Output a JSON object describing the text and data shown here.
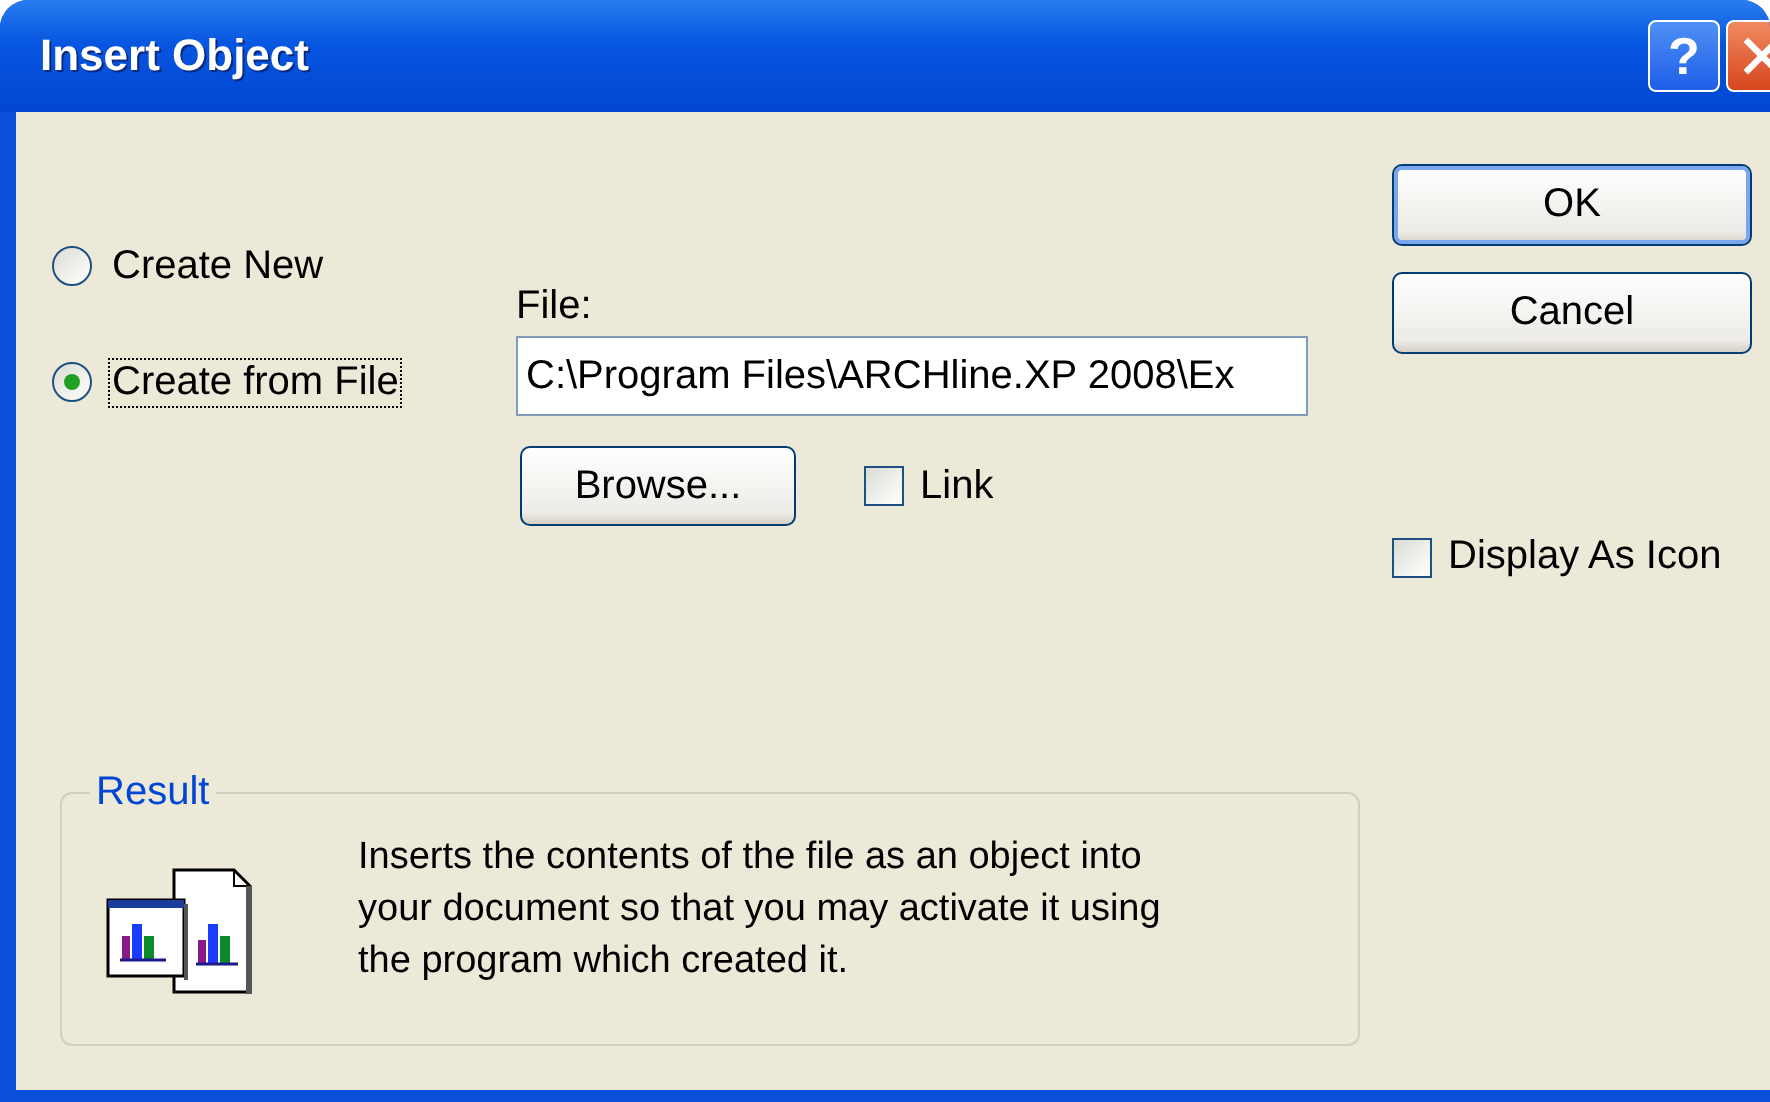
{
  "window": {
    "title": "Insert Object",
    "help_button": "?"
  },
  "source_options": [
    {
      "label": "Create New",
      "selected": false
    },
    {
      "label": "Create from File",
      "selected": true
    }
  ],
  "file": {
    "label": "File:",
    "value": "C:\\Program Files\\ARCHline.XP 2008\\Ex"
  },
  "browse_button": "Browse...",
  "link": {
    "label": "Link",
    "checked": false
  },
  "buttons": [
    "OK",
    "Cancel"
  ],
  "display_as_icon": {
    "label": "Display As Icon",
    "checked": false
  },
  "result": {
    "title": "Result",
    "text": "Inserts the contents of the file as an object into your document so that you may activate it using the program which created it."
  }
}
